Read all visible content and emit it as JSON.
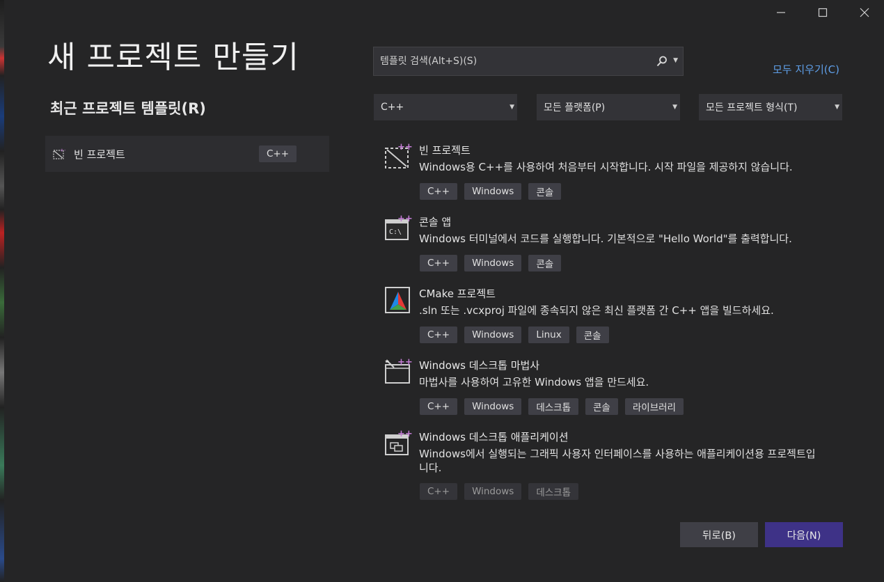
{
  "window": {
    "title": "새 프로젝트 만들기",
    "controls": [
      "minimize-icon",
      "maximize-icon",
      "close-icon"
    ]
  },
  "recent": {
    "heading": "최근 프로젝트 템플릿(R)",
    "items": [
      {
        "label": "빈 프로젝트",
        "tag": "C++",
        "icon": "empty-project-icon"
      }
    ]
  },
  "search": {
    "placeholder": "템플릿 검색(Alt+S)(S)",
    "value": "",
    "icon": "search-icon"
  },
  "clear_all": "모두 지우기(C)",
  "filters": {
    "language": "C++",
    "platform": "모든 플랫폼(P)",
    "project_type": "모든 프로젝트 형식(T)"
  },
  "templates": [
    {
      "name": "빈 프로젝트",
      "description": "Windows용 C++를 사용하여 처음부터 시작합니다. 시작 파일을 제공하지 않습니다.",
      "tags": [
        "C++",
        "Windows",
        "콘솔"
      ],
      "icon": "empty-project-icon"
    },
    {
      "name": "콘솔 앱",
      "description": "Windows 터미널에서 코드를 실행합니다. 기본적으로 \"Hello World\"를 출력합니다.",
      "tags": [
        "C++",
        "Windows",
        "콘솔"
      ],
      "icon": "console-app-icon"
    },
    {
      "name": "CMake 프로젝트",
      "description": ".sln 또는 .vcxproj 파일에 종속되지 않은 최신 플랫폼 간 C++ 앱을 빌드하세요.",
      "tags": [
        "C++",
        "Windows",
        "Linux",
        "콘솔"
      ],
      "icon": "cmake-icon"
    },
    {
      "name": "Windows 데스크톱 마법사",
      "description": "마법사를 사용하여 고유한 Windows 앱을 만드세요.",
      "tags": [
        "C++",
        "Windows",
        "데스크톱",
        "콘솔",
        "라이브러리"
      ],
      "icon": "desktop-wizard-icon"
    },
    {
      "name": "Windows 데스크톱 애플리케이션",
      "description": "Windows에서 실행되는 그래픽 사용자 인터페이스를 사용하는 애플리케이션용 프로젝트입니다.",
      "tags": [
        "C++",
        "Windows",
        "데스크톱"
      ],
      "icon": "desktop-app-icon"
    }
  ],
  "buttons": {
    "back": "뒤로(B)",
    "next": "다음(N)"
  },
  "colors": {
    "background": "#252526",
    "accent_button": "#3e3287",
    "link": "#5f9fe8",
    "tag_bg": "#3f3f46",
    "icon_plus": "#c47dd6"
  }
}
